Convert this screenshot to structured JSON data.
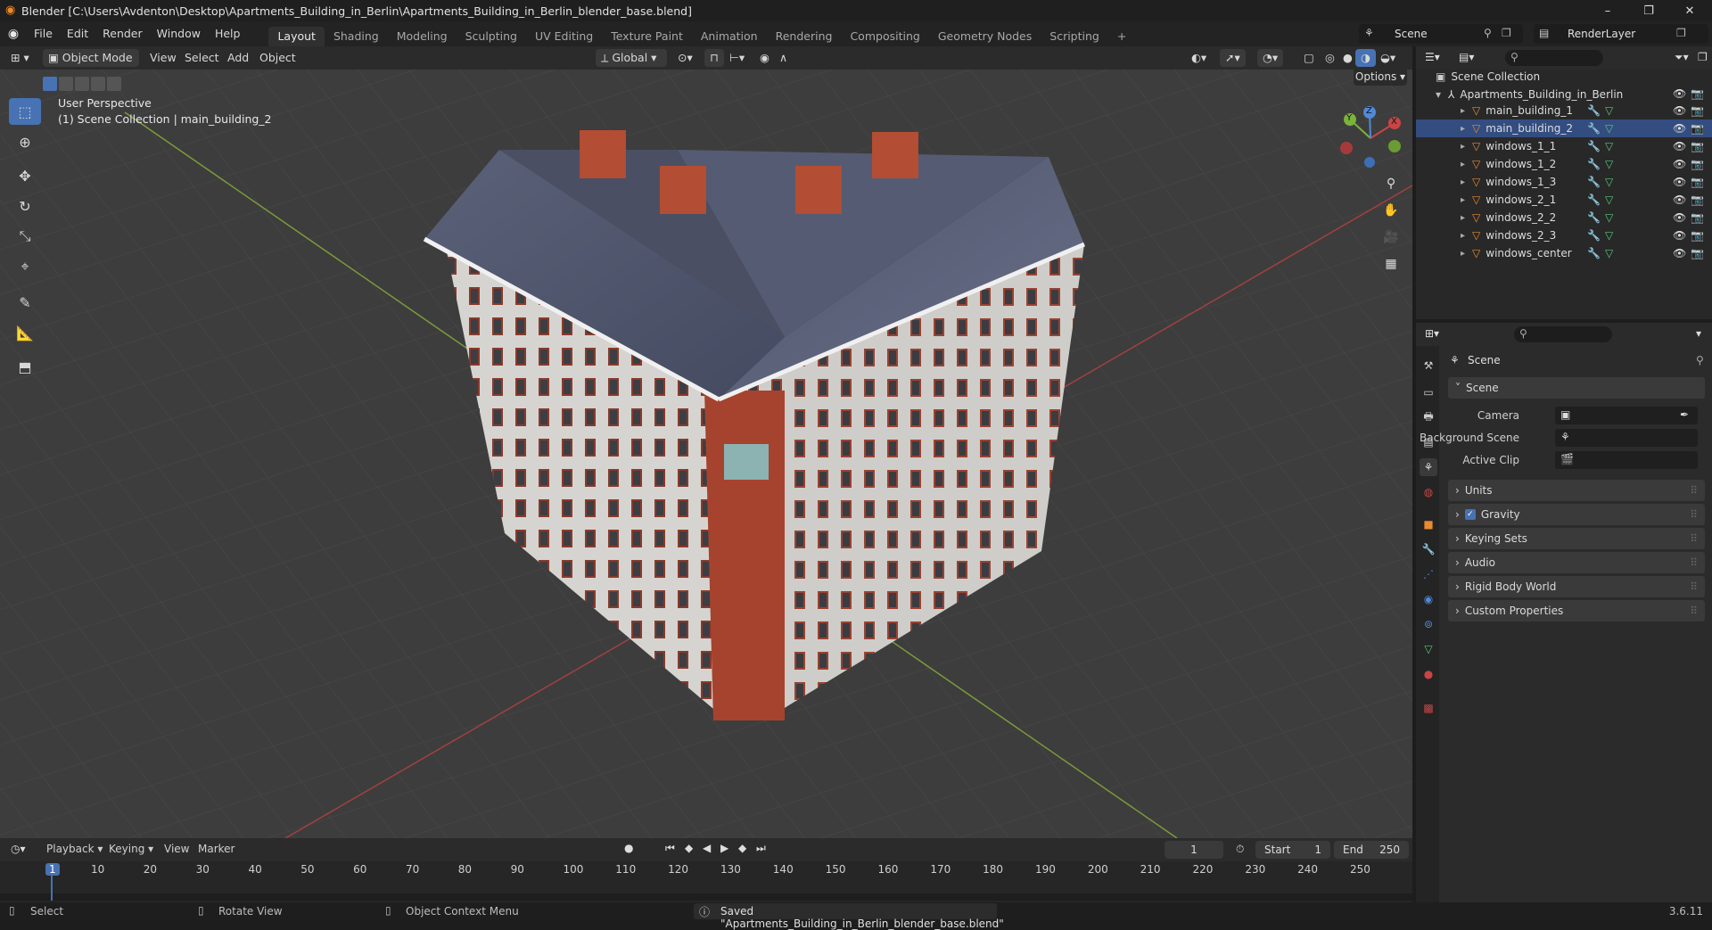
{
  "window": {
    "title": "Blender [C:\\Users\\Avdenton\\Desktop\\Apartments_Building_in_Berlin\\Apartments_Building_in_Berlin_blender_base.blend]",
    "minimize": "–",
    "maximize": "❐",
    "close": "✕"
  },
  "menus": [
    "File",
    "Edit",
    "Render",
    "Window",
    "Help"
  ],
  "workspaces": [
    "Layout",
    "Shading",
    "Modeling",
    "Sculpting",
    "UV Editing",
    "Texture Paint",
    "Animation",
    "Rendering",
    "Compositing",
    "Geometry Nodes",
    "Scripting"
  ],
  "add_workspace": "+",
  "scene_selector": {
    "value": "Scene"
  },
  "view_layer_selector": {
    "value": "RenderLayer"
  },
  "viewport_header": {
    "mode": "Object Mode",
    "menus": [
      "View",
      "Select",
      "Add",
      "Object"
    ],
    "transform_orientation": "Global",
    "options": "Options"
  },
  "viewport": {
    "perspective": "User Perspective",
    "collection_info": "(1) Scene Collection | main_building_2",
    "gizmo": {
      "x": "X",
      "y": "Y",
      "z": "Z"
    }
  },
  "outliner": {
    "root": "Scene Collection",
    "collection": "Apartments_Building_in_Berlin",
    "objects": [
      "main_building_1",
      "main_building_2",
      "windows_1_1",
      "windows_1_2",
      "windows_1_3",
      "windows_2_1",
      "windows_2_2",
      "windows_2_3",
      "windows_center"
    ],
    "active_object": "main_building_2"
  },
  "properties": {
    "breadcrumb": "Scene",
    "panel_scene": "Scene",
    "camera_label": "Camera",
    "background_scene_label": "Background Scene",
    "active_clip_label": "Active Clip",
    "panels": [
      "Units",
      "Gravity",
      "Keying Sets",
      "Audio",
      "Rigid Body World",
      "Custom Properties"
    ],
    "gravity_checked": true
  },
  "timeline": {
    "menus": [
      "Playback",
      "Keying",
      "View",
      "Marker"
    ],
    "current_frame": "1",
    "start_label": "Start",
    "start_value": "1",
    "end_label": "End",
    "end_value": "250",
    "ticks": [
      "1",
      "10",
      "20",
      "30",
      "40",
      "50",
      "60",
      "70",
      "80",
      "90",
      "100",
      "110",
      "120",
      "130",
      "140",
      "150",
      "160",
      "170",
      "180",
      "190",
      "200",
      "210",
      "220",
      "230",
      "240",
      "250"
    ]
  },
  "statusbar": {
    "select": "Select",
    "rotate": "Rotate View",
    "context": "Object Context Menu",
    "message": "Saved \"Apartments_Building_in_Berlin_blender_base.blend\"",
    "version": "3.6.11"
  },
  "colors": {
    "accent": "#4772b3",
    "axis_x": "#c94545",
    "axis_y": "#7bb33a",
    "axis_z": "#4f8ad8",
    "object_orange": "#e88a2e",
    "mesh_green": "#54c87a"
  }
}
